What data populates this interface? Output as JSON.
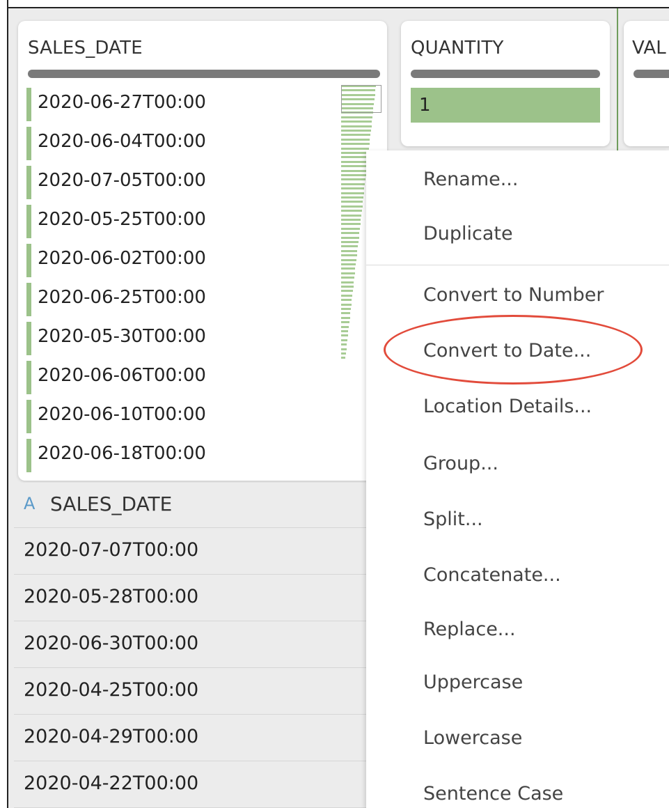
{
  "columns": {
    "sales_date": {
      "header": "SALES_DATE",
      "values": [
        "2020-06-27T00:00",
        "2020-06-04T00:00",
        "2020-07-05T00:00",
        "2020-05-25T00:00",
        "2020-06-02T00:00",
        "2020-06-25T00:00",
        "2020-05-30T00:00",
        "2020-06-06T00:00",
        "2020-06-10T00:00",
        "2020-06-18T00:00"
      ]
    },
    "quantity": {
      "header": "QUANTITY",
      "values": [
        "1"
      ]
    },
    "value": {
      "header": "VAL"
    }
  },
  "data_section": {
    "type_indicator": "A",
    "header": "SALES_DATE",
    "rows": [
      "2020-07-07T00:00",
      "2020-05-28T00:00",
      "2020-06-30T00:00",
      "2020-04-25T00:00",
      "2020-04-29T00:00",
      "2020-04-22T00:00"
    ]
  },
  "context_menu": {
    "group1": [
      "Rename...",
      "Duplicate"
    ],
    "group2": [
      "Convert to Number",
      "Convert to Date...",
      "Location Details...",
      "Group...",
      "Split...",
      "Concatenate...",
      "Replace...",
      "Uppercase",
      "Lowercase",
      "Sentence Case"
    ],
    "highlighted_item": "Convert to Date..."
  },
  "colors": {
    "bar_green": "#9cc28a",
    "highlight_red": "#e24b3b",
    "type_icon_blue": "#5b9ac9"
  }
}
